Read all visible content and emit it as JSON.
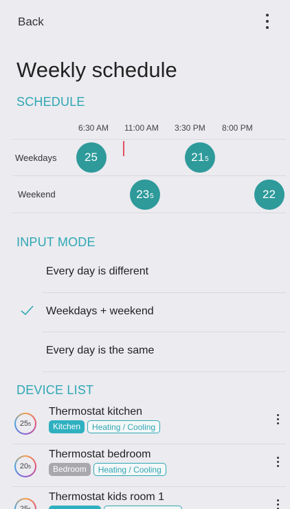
{
  "header": {
    "back_label": "Back",
    "menu_icon": "more-vertical-icon"
  },
  "page": {
    "title": "Weekly schedule"
  },
  "schedule": {
    "section_label": "SCHEDULE",
    "times": [
      "6:30 AM",
      "11:00 AM",
      "3:30 PM",
      "8:00 PM"
    ],
    "rows": [
      {
        "label": "Weekdays",
        "setpoints": [
          {
            "main": "25",
            "sub": ""
          },
          {
            "main": "21",
            "sub": "5"
          }
        ]
      },
      {
        "label": "Weekend",
        "setpoints": [
          {
            "main": "23",
            "sub": "5"
          },
          {
            "main": "22",
            "sub": ""
          }
        ]
      }
    ],
    "accent_color": "#2e9a9a",
    "now_marker_color": "#e25060"
  },
  "input_mode": {
    "section_label": "INPUT MODE",
    "options": [
      {
        "label": "Every day is different",
        "selected": false
      },
      {
        "label": "Weekdays + weekend",
        "selected": true
      },
      {
        "label": "Every day is the same",
        "selected": false
      }
    ]
  },
  "devices": {
    "section_label": "DEVICE LIST",
    "items": [
      {
        "temp": "25",
        "temp_sub": "5",
        "name": "Thermostat kitchen",
        "room": "Kitchen",
        "room_color": "#2fb0c0",
        "type": "Heating / Cooling"
      },
      {
        "temp": "20",
        "temp_sub": "5",
        "name": "Thermostat bedroom",
        "room": "Bedroom",
        "room_color": "#a8a8ad",
        "type": "Heating / Cooling"
      },
      {
        "temp": "25",
        "temp_sub": "5",
        "name": "Thermostat kids room 1",
        "room": "",
        "room_color": "#2fb0c0",
        "type": ""
      }
    ]
  }
}
